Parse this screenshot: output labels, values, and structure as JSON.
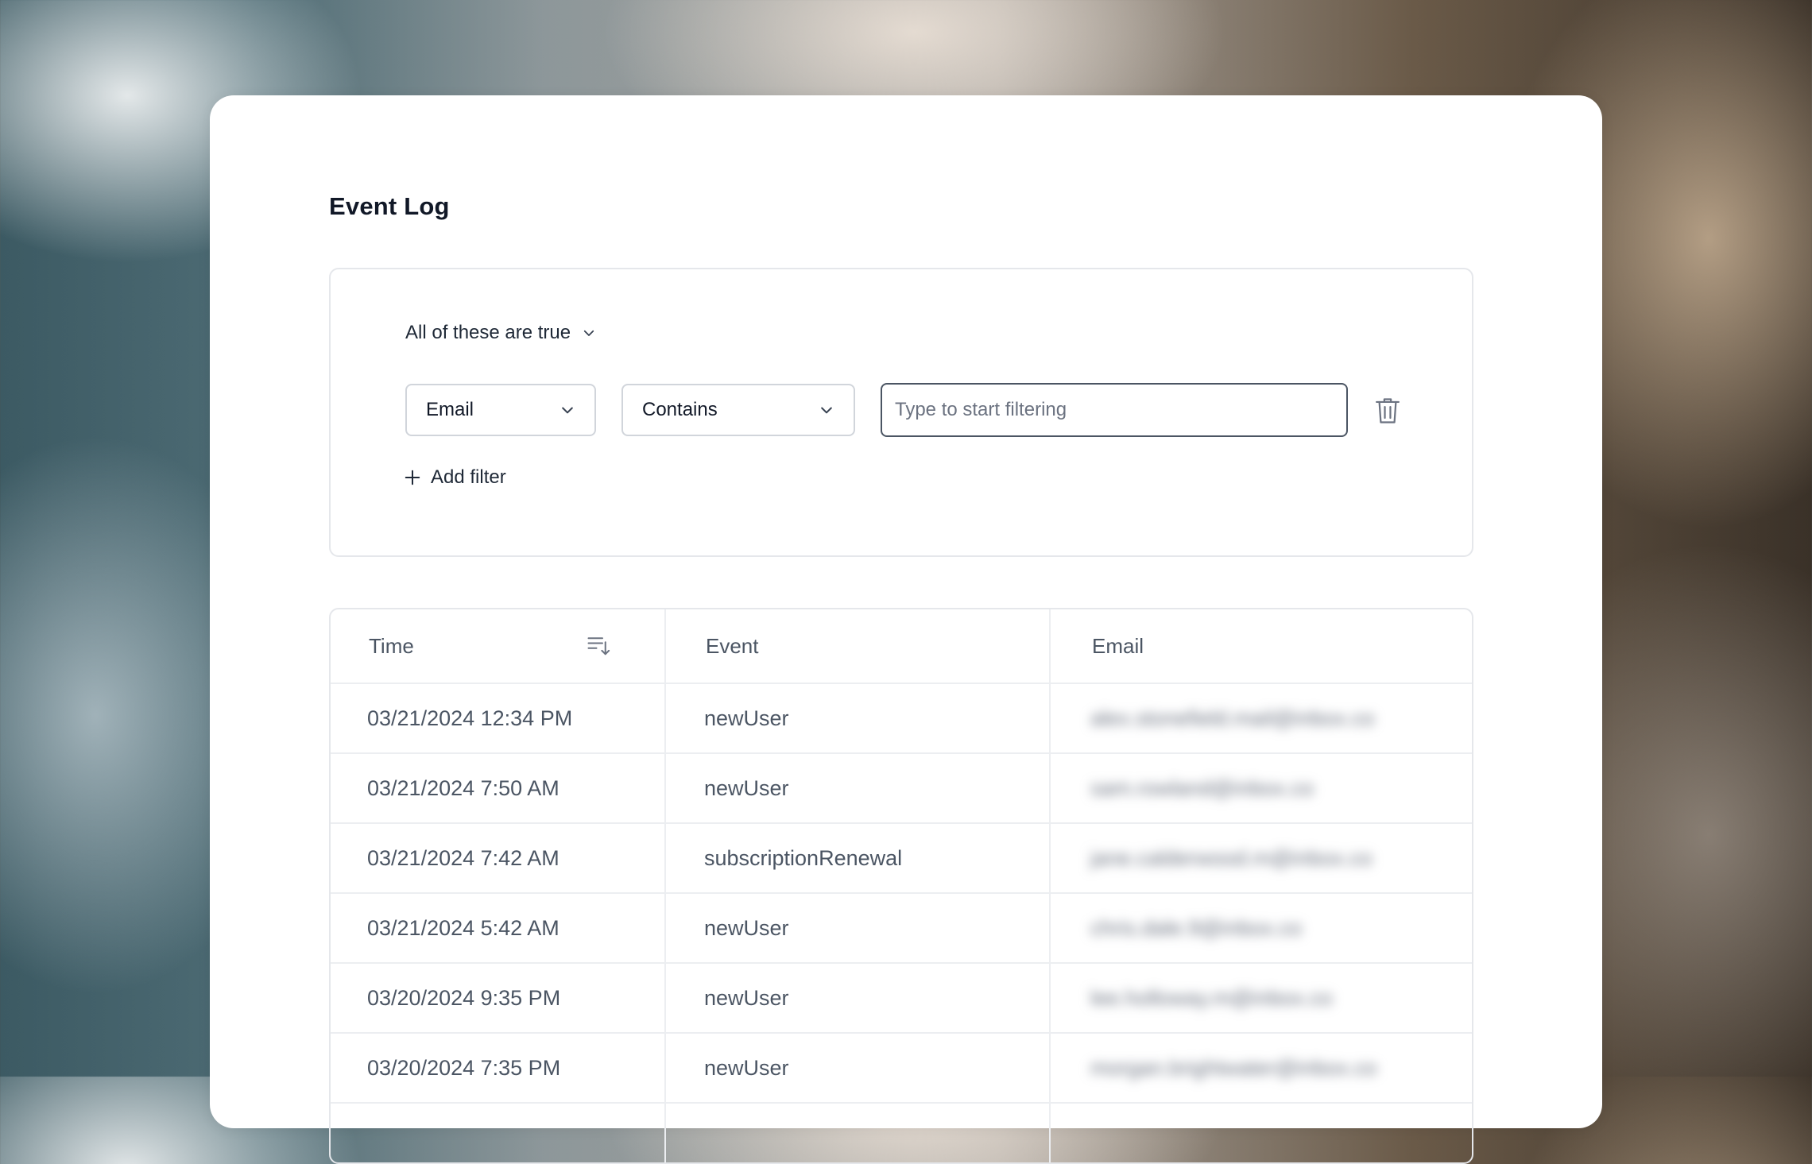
{
  "page": {
    "title": "Event Log"
  },
  "filters": {
    "match_mode": "All of these are true",
    "field": "Email",
    "operator": "Contains",
    "input_placeholder": "Type to start filtering",
    "add_filter_label": "Add filter"
  },
  "table": {
    "columns": {
      "time": "Time",
      "event": "Event",
      "email": "Email"
    },
    "rows": [
      {
        "time": "03/21/2024 12:34 PM",
        "event": "newUser",
        "email": "alex.stonefield.mail@inbox.co"
      },
      {
        "time": "03/21/2024 7:50 AM",
        "event": "newUser",
        "email": "sam.rowland@inbox.co"
      },
      {
        "time": "03/21/2024 7:42 AM",
        "event": "subscriptionRenewal",
        "email": "jane.calderwood.m@inbox.co"
      },
      {
        "time": "03/21/2024 5:42 AM",
        "event": "newUser",
        "email": "chris.dale.9@inbox.co"
      },
      {
        "time": "03/20/2024 9:35 PM",
        "event": "newUser",
        "email": "lee.holloway.m@inbox.co"
      },
      {
        "time": "03/20/2024 7:35 PM",
        "event": "newUser",
        "email": "morgan.brightwater@inbox.co"
      }
    ]
  },
  "icons": {
    "match_chevron": "chevron-down-icon",
    "field_chevron": "chevron-down-icon",
    "operator_chevron": "chevron-down-icon",
    "delete": "trash-icon",
    "add": "plus-icon",
    "sort": "sort-descending-icon"
  }
}
